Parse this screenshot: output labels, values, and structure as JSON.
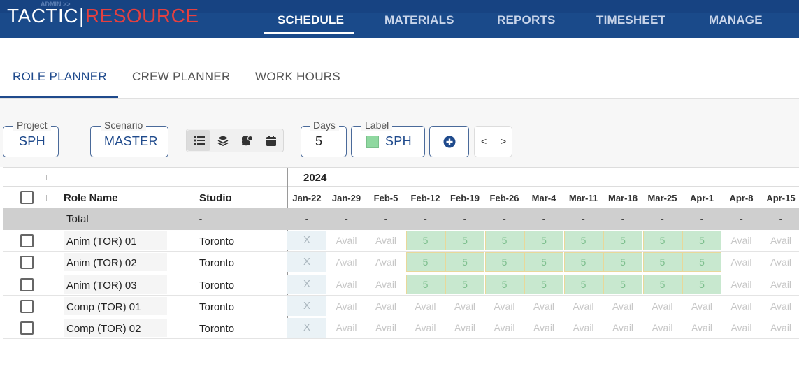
{
  "app": {
    "logo_left": "TACTIC",
    "logo_sep": "|",
    "logo_right": "RESOURCE",
    "logo_admin": "ADMIN >>",
    "nav": [
      "SCHEDULE",
      "MATERIALS",
      "REPORTS",
      "TIMESHEET",
      "MANAGE"
    ],
    "nav_active": "SCHEDULE"
  },
  "subtabs": [
    "ROLE PLANNER",
    "CREW PLANNER",
    "WORK HOURS"
  ],
  "subtab_active": "ROLE PLANNER",
  "filters": {
    "project_label": "Project",
    "project_value": "SPH",
    "scenario_label": "Scenario",
    "scenario_value": "MASTER",
    "days_label": "Days",
    "days_value": "5",
    "label_label": "Label",
    "label_value": "SPH",
    "label_color": "#8fd8a0"
  },
  "view_icons": [
    "list-icon",
    "layers-icon",
    "coins-stack-icon",
    "calendar-icon"
  ],
  "nav_prev": "<",
  "nav_next": ">",
  "grid": {
    "year": "2024",
    "col_role": "Role Name",
    "col_studio": "Studio",
    "weeks": [
      "Jan-22",
      "Jan-29",
      "Feb-5",
      "Feb-12",
      "Feb-19",
      "Feb-26",
      "Mar-4",
      "Mar-11",
      "Mar-18",
      "Mar-25",
      "Apr-1",
      "Apr-8",
      "Apr-15"
    ],
    "total_label": "Total",
    "total_studio": "-",
    "total_value": "-",
    "rows": [
      {
        "role": "Anim (TOR) 01",
        "studio": "Toronto",
        "cells": [
          "X",
          "Avail",
          "Avail",
          "5",
          "5",
          "5",
          "5",
          "5",
          "5",
          "5",
          "5",
          "Avail",
          "Avail"
        ]
      },
      {
        "role": "Anim (TOR) 02",
        "studio": "Toronto",
        "cells": [
          "X",
          "Avail",
          "Avail",
          "5",
          "5",
          "5",
          "5",
          "5",
          "5",
          "5",
          "5",
          "Avail",
          "Avail"
        ]
      },
      {
        "role": "Anim (TOR) 03",
        "studio": "Toronto",
        "cells": [
          "X",
          "Avail",
          "Avail",
          "5",
          "5",
          "5",
          "5",
          "5",
          "5",
          "5",
          "5",
          "Avail",
          "Avail"
        ]
      },
      {
        "role": "Comp (TOR) 01",
        "studio": "Toronto",
        "cells": [
          "X",
          "Avail",
          "Avail",
          "Avail",
          "Avail",
          "Avail",
          "Avail",
          "Avail",
          "Avail",
          "Avail",
          "Avail",
          "Avail",
          "Avail"
        ]
      },
      {
        "role": "Comp (TOR) 02",
        "studio": "Toronto",
        "cells": [
          "X",
          "Avail",
          "Avail",
          "Avail",
          "Avail",
          "Avail",
          "Avail",
          "Avail",
          "Avail",
          "Avail",
          "Avail",
          "Avail",
          "Avail"
        ]
      }
    ]
  },
  "colors": {
    "header_bg": "#1a4a8a",
    "brand_red": "#e44040",
    "assigned_bg": "#c8e8cf",
    "accent_blue": "#1f4a8c"
  }
}
